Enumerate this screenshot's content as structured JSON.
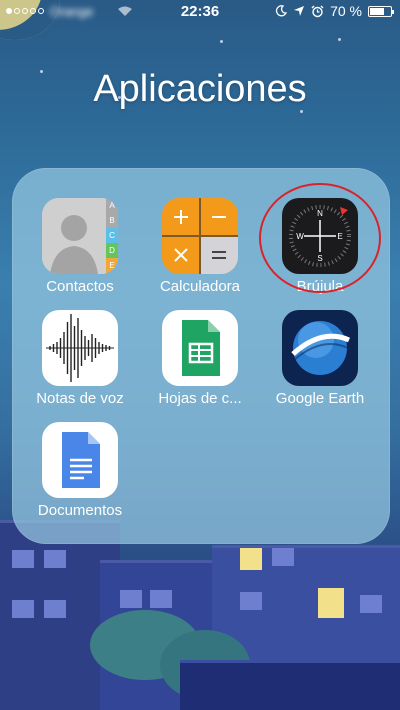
{
  "status_bar": {
    "carrier": "Orange",
    "time": "22:36",
    "battery_percent": "70 %",
    "battery_level": 0.7,
    "signal_dots": 5,
    "signal_filled": 1
  },
  "folder": {
    "title": "Aplicaciones",
    "apps": [
      {
        "label": "Contactos",
        "icon": "contacts-icon"
      },
      {
        "label": "Calculadora",
        "icon": "calculator-icon"
      },
      {
        "label": "Brújula",
        "icon": "compass-icon"
      },
      {
        "label": "Notas de voz",
        "icon": "voice-memos-icon"
      },
      {
        "label": "Hojas de c...",
        "icon": "sheets-icon"
      },
      {
        "label": "Google Earth",
        "icon": "google-earth-icon"
      },
      {
        "label": "Documentos",
        "icon": "docs-icon"
      }
    ]
  },
  "compass_letters": {
    "n": "N",
    "e": "E",
    "s": "S",
    "w": "W"
  },
  "contacts_tabs": [
    "A",
    "B",
    "C",
    "D",
    "E"
  ],
  "colors": {
    "calculator_orange": "#f39a1a",
    "sheets_green": "#1fa463",
    "docs_blue": "#4a86e8",
    "highlight_red": "#d8232a"
  }
}
